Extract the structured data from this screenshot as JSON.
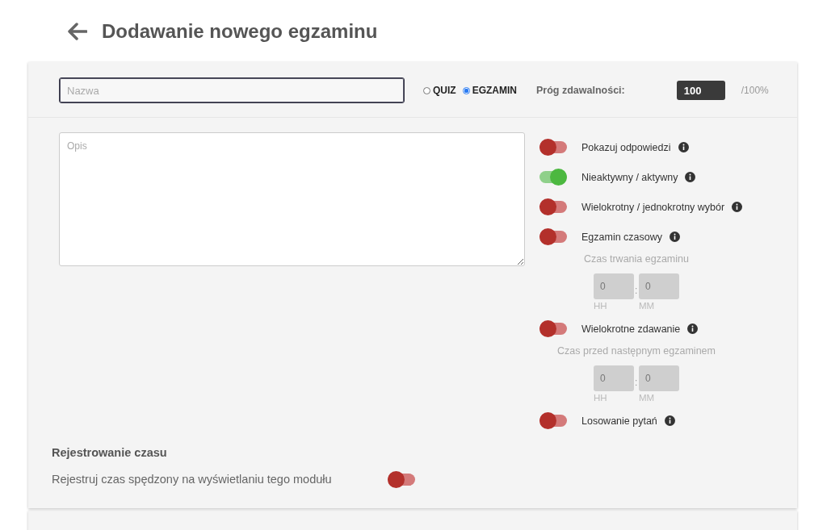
{
  "page_title": "Dodawanie nowego egzaminu",
  "name_field": {
    "placeholder": "Nazwa"
  },
  "exam_type": [
    {
      "label": "QUIZ",
      "selected": false
    },
    {
      "label": "EGZAMIN",
      "selected": true
    }
  ],
  "threshold": {
    "label": "Próg zdawalności:",
    "value": "100",
    "suffix": "/100%"
  },
  "description_field": {
    "placeholder": "Opis"
  },
  "settings": [
    {
      "kind": "toggle",
      "label": "Pokazuj odpowiedzi",
      "on": false
    },
    {
      "kind": "toggle",
      "label": "Nieaktywny / aktywny",
      "on": true
    },
    {
      "kind": "toggle",
      "label": "Wielokrotny / jednokrotny wybór",
      "on": false
    },
    {
      "kind": "toggle",
      "label": "Egzamin czasowy",
      "on": false
    },
    {
      "kind": "duration",
      "label": "Czas trwania egzaminu",
      "separator": ":",
      "fields": [
        {
          "placeholder": "0",
          "unit": "HH"
        },
        {
          "placeholder": "0",
          "unit": "MM"
        }
      ]
    },
    {
      "kind": "toggle",
      "label": "Wielokrotne zdawanie",
      "on": false
    },
    {
      "kind": "duration",
      "label": "Czas przed następnym egzaminem",
      "separator": ":",
      "fields": [
        {
          "placeholder": "0",
          "unit": "HH"
        },
        {
          "placeholder": "0",
          "unit": "MM"
        }
      ]
    },
    {
      "kind": "toggle",
      "label": "Losowanie pytań",
      "on": false
    }
  ],
  "time_tracking": {
    "heading": "Rejestrowanie czasu",
    "label": "Rejestruj czas spędzony na wyświetlaniu tego modułu",
    "on": false
  }
}
